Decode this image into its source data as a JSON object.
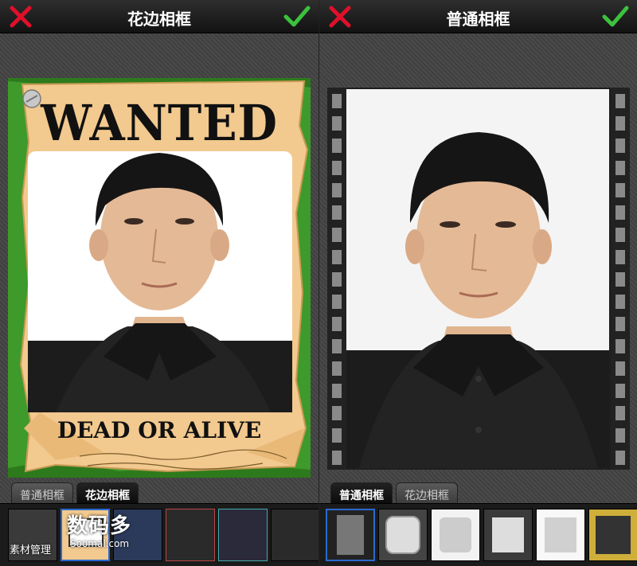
{
  "left": {
    "title": "花边相框",
    "tabs": [
      {
        "label": "普通相框"
      },
      {
        "label": "花边相框"
      }
    ],
    "active_tab": 1,
    "poster": {
      "headline": "WANTED",
      "footer": "DEAD OR ALIVE"
    },
    "watermark": {
      "logo_text": "数码多",
      "site": "Soomal.com",
      "label": "素材管理"
    }
  },
  "right": {
    "title": "普通相框",
    "tabs": [
      {
        "label": "普通相框"
      },
      {
        "label": "花边相框"
      }
    ],
    "active_tab": 0
  },
  "colors": {
    "cancel": "#e0102a",
    "confirm": "#3cc23c",
    "poster_paper": "#f2c98e",
    "poster_green": "#3e9a2a"
  },
  "icons": [
    "close-icon",
    "checkmark-icon",
    "pin-icon",
    "film-strip-icon"
  ]
}
